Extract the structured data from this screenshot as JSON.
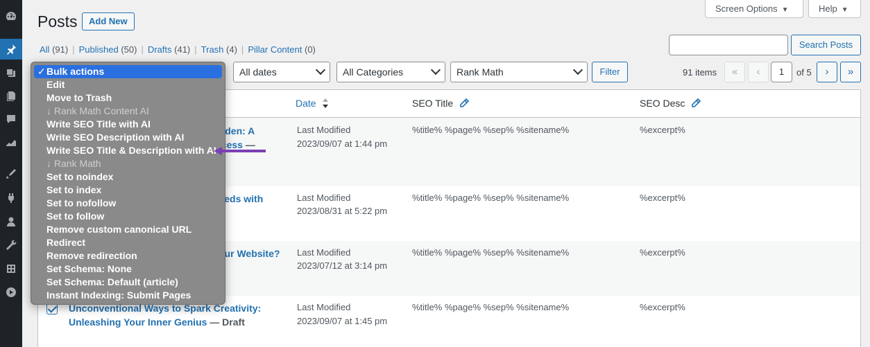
{
  "header": {
    "title": "Posts",
    "add_new": "Add New",
    "screen_options": "Screen Options",
    "help": "Help"
  },
  "views": [
    {
      "label": "All",
      "count": "(91)"
    },
    {
      "label": "Published",
      "count": "(50)"
    },
    {
      "label": "Drafts",
      "count": "(41)"
    },
    {
      "label": "Trash",
      "count": "(4)"
    },
    {
      "label": "Pillar Content",
      "count": "(0)"
    }
  ],
  "search": {
    "button": "Search Posts",
    "value": ""
  },
  "filters": {
    "dates": "All dates",
    "categories": "All Categories",
    "rank_math": "Rank Math",
    "filter_button": "Filter"
  },
  "pagination": {
    "items": "91 items",
    "first": "«",
    "prev": "‹",
    "current": "1",
    "of": "of 5",
    "next": "›",
    "last": "»"
  },
  "columns": {
    "date": "Date",
    "seo_title": "SEO Title",
    "seo_desc": "SEO Desc"
  },
  "rows": [
    {
      "title_l1": "arden: A",
      "title_l2": "ccess",
      "title_l2_suffix": " —",
      "date_l1": "Last Modified",
      "date_l2": "2023/09/07 at 1:44 pm",
      "seo_title": "%title% %page% %sep% %sitename%",
      "seo_desc": "%excerpt%"
    },
    {
      "title_l1": "reeds with",
      "date_l1": "Last Modified",
      "date_l2": "2023/08/31 at 5:22 pm",
      "seo_title": "%title% %page% %sep% %sitename%",
      "seo_desc": "%excerpt%"
    },
    {
      "title_l1": "our Website?",
      "date_l1": "Last Modified",
      "date_l2": "2023/07/12 at 3:14 pm",
      "seo_title": "%title% %page% %sep% %sitename%",
      "seo_desc": "%excerpt%"
    },
    {
      "title_l1": "Unconventional Ways to Spark Creativity:",
      "title_l2": "Unleashing Your Inner Genius",
      "state": " — Draft",
      "date_l1": "Last Modified",
      "date_l2": "2023/09/07 at 1:45 pm",
      "seo_title": "%title% %page% %sep% %sitename%",
      "seo_desc": "%excerpt%"
    }
  ],
  "bulk_menu": {
    "items": [
      {
        "label": "Bulk actions",
        "kind": "selected",
        "tick": "✓"
      },
      {
        "label": "Edit",
        "kind": "option"
      },
      {
        "label": "Move to Trash",
        "kind": "option"
      },
      {
        "label": "↓ Rank Math Content AI",
        "kind": "group"
      },
      {
        "label": "Write SEO Title with AI",
        "kind": "option"
      },
      {
        "label": "Write SEO Description with AI",
        "kind": "option"
      },
      {
        "label": "Write SEO Title & Description with AI",
        "kind": "option"
      },
      {
        "label": "↓ Rank Math",
        "kind": "group"
      },
      {
        "label": "Set to noindex",
        "kind": "option"
      },
      {
        "label": "Set to index",
        "kind": "option"
      },
      {
        "label": "Set to nofollow",
        "kind": "option"
      },
      {
        "label": "Set to follow",
        "kind": "option"
      },
      {
        "label": "Remove custom canonical URL",
        "kind": "option"
      },
      {
        "label": "Redirect",
        "kind": "option"
      },
      {
        "label": "Remove redirection",
        "kind": "option"
      },
      {
        "label": "Set Schema: None",
        "kind": "option"
      },
      {
        "label": "Set Schema: Default (article)",
        "kind": "option"
      },
      {
        "label": "Instant Indexing: Submit Pages",
        "kind": "option"
      }
    ]
  },
  "colors": {
    "accent": "#2271b1",
    "sidebar": "#1d2327",
    "annotation_arrow": "#7b3fb5"
  }
}
